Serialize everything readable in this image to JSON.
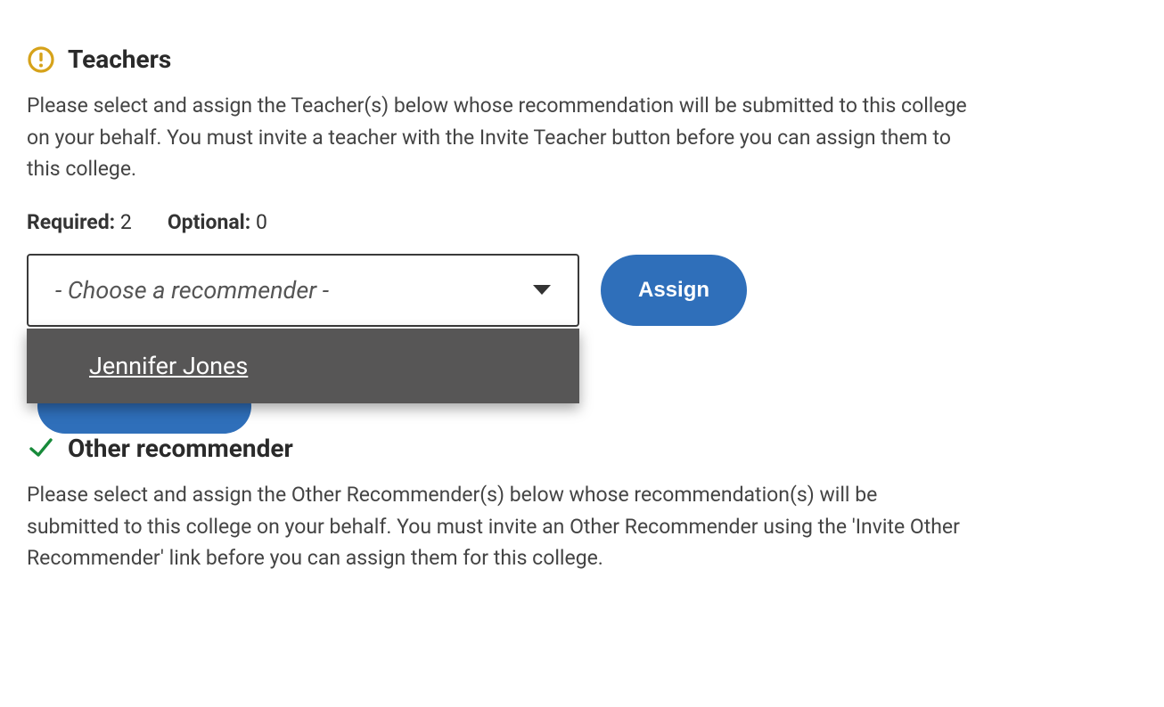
{
  "teachers": {
    "title": "Teachers",
    "description": "Please select and assign the Teacher(s) below whose recommendation will be submitted to this college on your behalf. You must invite a teacher with the Invite Teacher button before you can assign them to this college.",
    "required_label": "Required:",
    "required_count": "2",
    "optional_label": "Optional:",
    "optional_count": "0",
    "dropdown_placeholder": "- Choose a recommender -",
    "dropdown_options": [
      "Jennifer Jones"
    ],
    "assign_label": "Assign"
  },
  "other": {
    "title": "Other recommender",
    "description": "Please select and assign the Other Recommender(s) below whose recommendation(s) will be submitted to this college on your behalf. You must invite an Other Recommender using the 'Invite Other Recommender' link before you can assign them for this college."
  }
}
